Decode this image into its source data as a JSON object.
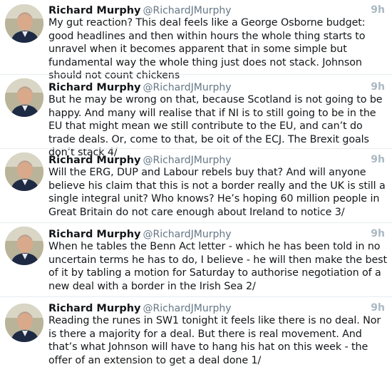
{
  "tweets": [
    {
      "name": "Richard Murphy",
      "handle": "@RichardJMurphy",
      "time": "9h",
      "text": "My gut reaction? This deal feels like a George Osborne budget: good headlines and then within hours the whole thing starts to unravel when it becomes apparent that in some simple but fundamental way the whole thing just does not stack. Johnson should not count chickens"
    },
    {
      "name": "Richard Murphy",
      "handle": "@RichardJMurphy",
      "time": "9h",
      "text": "But he may be wrong on that, because Scotland is not going to be happy. And many will realise that if NI is to still going to be in the EU that might mean we still contribute to the EU, and can’t do trade deals. Or, come to that, be oit of the ECJ. The Brexit goals don’t stack 4/"
    },
    {
      "name": "Richard Murphy",
      "handle": "@RichardJMurphy",
      "time": "9h",
      "text": "Will the ERG, DUP and Labour rebels buy that? And will anyone believe his claim that this is not a border really and the UK is still a single integral unit? Who knows? He’s hoping 60 million people in Great Britain do not care enough about Ireland to notice 3/"
    },
    {
      "name": "Richard Murphy",
      "handle": "@RichardJMurphy",
      "time": "9h",
      "text": "When he tables the Benn Act letter - which he has been told in no uncertain terms he has to do, I believe - he will then make the best of it by tabling a motion for Saturday to authorise negotiation of a new deal with a border in the Irish Sea 2/"
    },
    {
      "name": "Richard Murphy",
      "handle": "@RichardJMurphy",
      "time": "9h",
      "text": "Reading the runes in SW1 tonight it feels like there is no deal. Nor is there a majority for a deal. But there is real movement. And that’s what Johnson will have to hang his hat on this week - the offer of an extension to get a deal done 1/"
    }
  ]
}
